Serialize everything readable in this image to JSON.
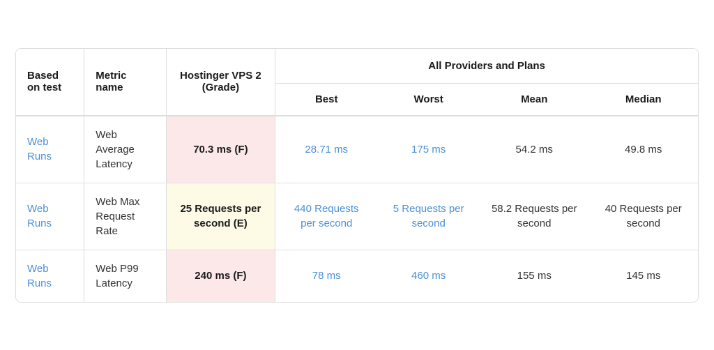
{
  "table": {
    "headers": {
      "based_on_test": "Based on test",
      "metric_name": "Metric name",
      "hostinger": "Hostinger VPS 2 (Grade)",
      "all_providers": "All Providers and Plans",
      "best": "Best",
      "worst": "Worst",
      "mean": "Mean",
      "median": "Median"
    },
    "rows": [
      {
        "based_on_test": "Web Runs",
        "metric_name": "Web Average Latency",
        "hostinger_value": "70.3 ms (F)",
        "hostinger_grade": "F",
        "bg": "pink",
        "best": "28.71 ms",
        "best_link": true,
        "worst": "175 ms",
        "worst_link": true,
        "mean": "54.2 ms",
        "mean_link": false,
        "median": "49.8 ms",
        "median_link": false
      },
      {
        "based_on_test": "Web Runs",
        "metric_name": "Web Max Request Rate",
        "hostinger_value": "25 Requests per second (E)",
        "hostinger_grade": "E",
        "bg": "yellow",
        "best": "440 Requests per second",
        "best_link": true,
        "worst": "5 Requests per second",
        "worst_link": true,
        "mean": "58.2 Requests per second",
        "mean_link": false,
        "median": "40 Requests per second",
        "median_link": false
      },
      {
        "based_on_test": "Web Runs",
        "metric_name": "Web P99 Latency",
        "hostinger_value": "240 ms (F)",
        "hostinger_grade": "F",
        "bg": "pink",
        "best": "78 ms",
        "best_link": true,
        "worst": "460 ms",
        "worst_link": true,
        "mean": "155 ms",
        "mean_link": false,
        "median": "145 ms",
        "median_link": false
      }
    ]
  }
}
